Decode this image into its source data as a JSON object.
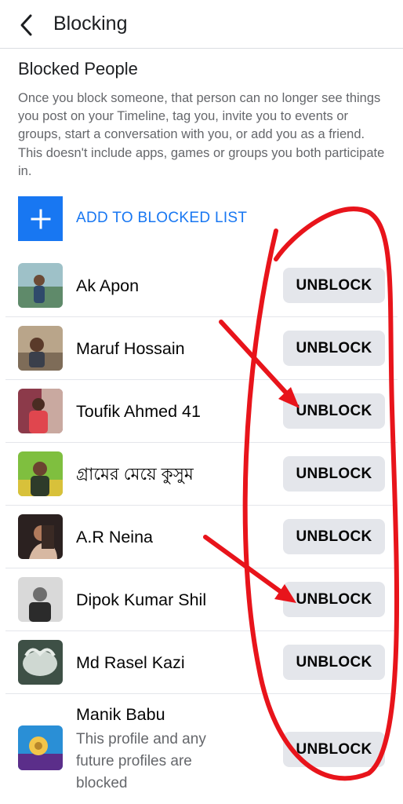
{
  "header": {
    "title": "Blocking",
    "back_icon": "chevron-left-icon"
  },
  "section": {
    "title": "Blocked People",
    "description": "Once you block someone, that person can no longer see things you post on your Timeline, tag you, invite you to events or groups, start a conversation with you, or add you as a friend. This doesn't include apps, games or groups you both participate in."
  },
  "add_blocked": {
    "label": "ADD TO BLOCKED LIST",
    "icon": "plus-icon"
  },
  "colors": {
    "accent": "#1877f2",
    "button_bg": "#e4e6eb",
    "annotation": "#e8141b"
  },
  "blocked": [
    {
      "name": "Ak Apon",
      "button": "UNBLOCK"
    },
    {
      "name": "Maruf Hossain",
      "button": "UNBLOCK"
    },
    {
      "name": "Toufik Ahmed 41",
      "button": "UNBLOCK"
    },
    {
      "name": "গ্রামের মেয়ে কুসুম",
      "button": "UNBLOCK"
    },
    {
      "name": "A.R Neina",
      "button": "UNBLOCK"
    },
    {
      "name": "Dipok Kumar Shil",
      "button": "UNBLOCK"
    },
    {
      "name": "Md Rasel Kazi",
      "button": "UNBLOCK"
    },
    {
      "name": "Manik Babu",
      "subtitle": "This profile and any future profiles are blocked",
      "button": "UNBLOCK"
    }
  ]
}
